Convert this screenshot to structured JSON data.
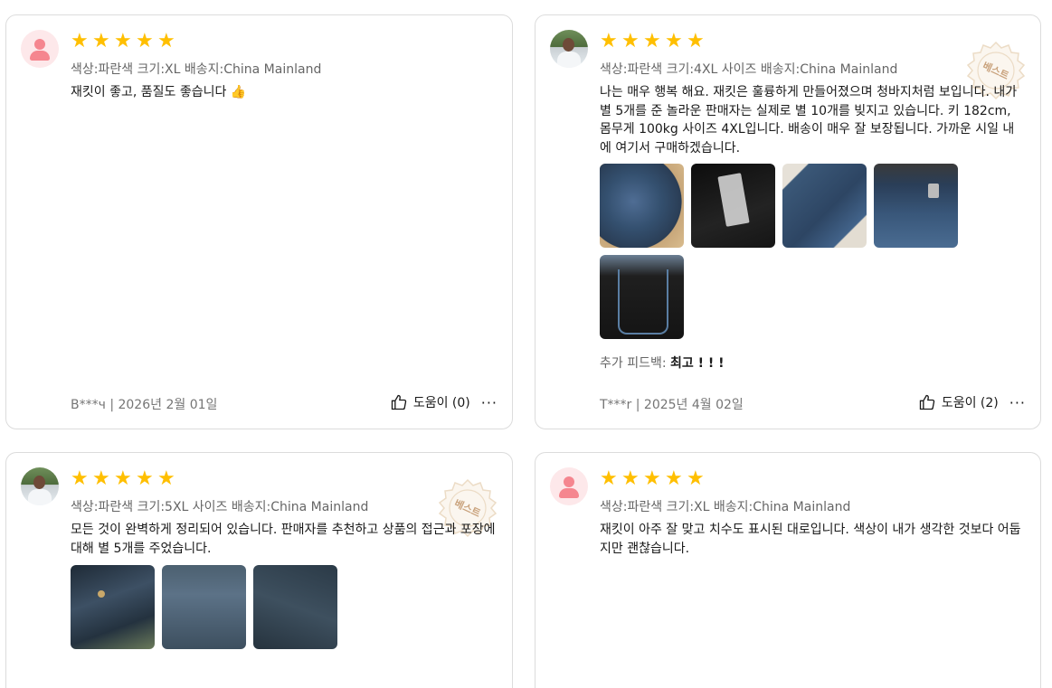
{
  "reviews": [
    {
      "avatar": "default-user-icon",
      "stars": "★★★★★",
      "meta": "색상:파란색 크기:XL 배송지:China Mainland",
      "text": "재킷이 좋고, 품질도 좋습니다 👍",
      "footer": "B***ч | 2026년 2월 01일",
      "helpful": "도움이 (0)",
      "more": "···"
    },
    {
      "avatar": "user-photo",
      "stars": "★★★★★",
      "meta": "색상:파란색 크기:4XL 사이즈 배송지:China Mainland",
      "text": "나는 매우 행복 해요. 재킷은 훌륭하게 만들어졌으며 청바지처럼 보입니다. 내가 별 5개를 준 놀라운 판매자는 실제로 별 10개를 빚지고 있습니다. 키 182cm, 몸무게 100kg 사이즈 4XL입니다. 배송이 매우 잘 보장됩니다. 가까운 시일 내에 여기서 구매하겠습니다.",
      "badge": "베스트",
      "extra_label": "추가 피드백: ",
      "extra_value": "최고 ! ! !",
      "footer": "T***r | 2025년 4월 02일",
      "helpful": "도움이 (2)",
      "more": "···"
    },
    {
      "avatar": "user-photo",
      "stars": "★★★★★",
      "meta": "색상:파란색 크기:5XL 사이즈 배송지:China Mainland",
      "text": "모든 것이 완벽하게 정리되어 있습니다. 판매자를 추천하고 상품의 접근과 포장에 대해 별 5개를 주었습니다.",
      "badge": "베스트"
    },
    {
      "avatar": "default-user-icon",
      "stars": "★★★★★",
      "meta": "색상:파란색 크기:XL 배송지:China Mainland",
      "text": "재킷이 아주 잘 맞고 치수도 표시된 대로입니다. 색상이 내가 생각한 것보다 어둡지만 괜찮습니다."
    }
  ],
  "colors": {
    "star": "#ffbf00",
    "border": "#dcdcdc",
    "meta": "#666666",
    "badge": "#c9a27c"
  }
}
